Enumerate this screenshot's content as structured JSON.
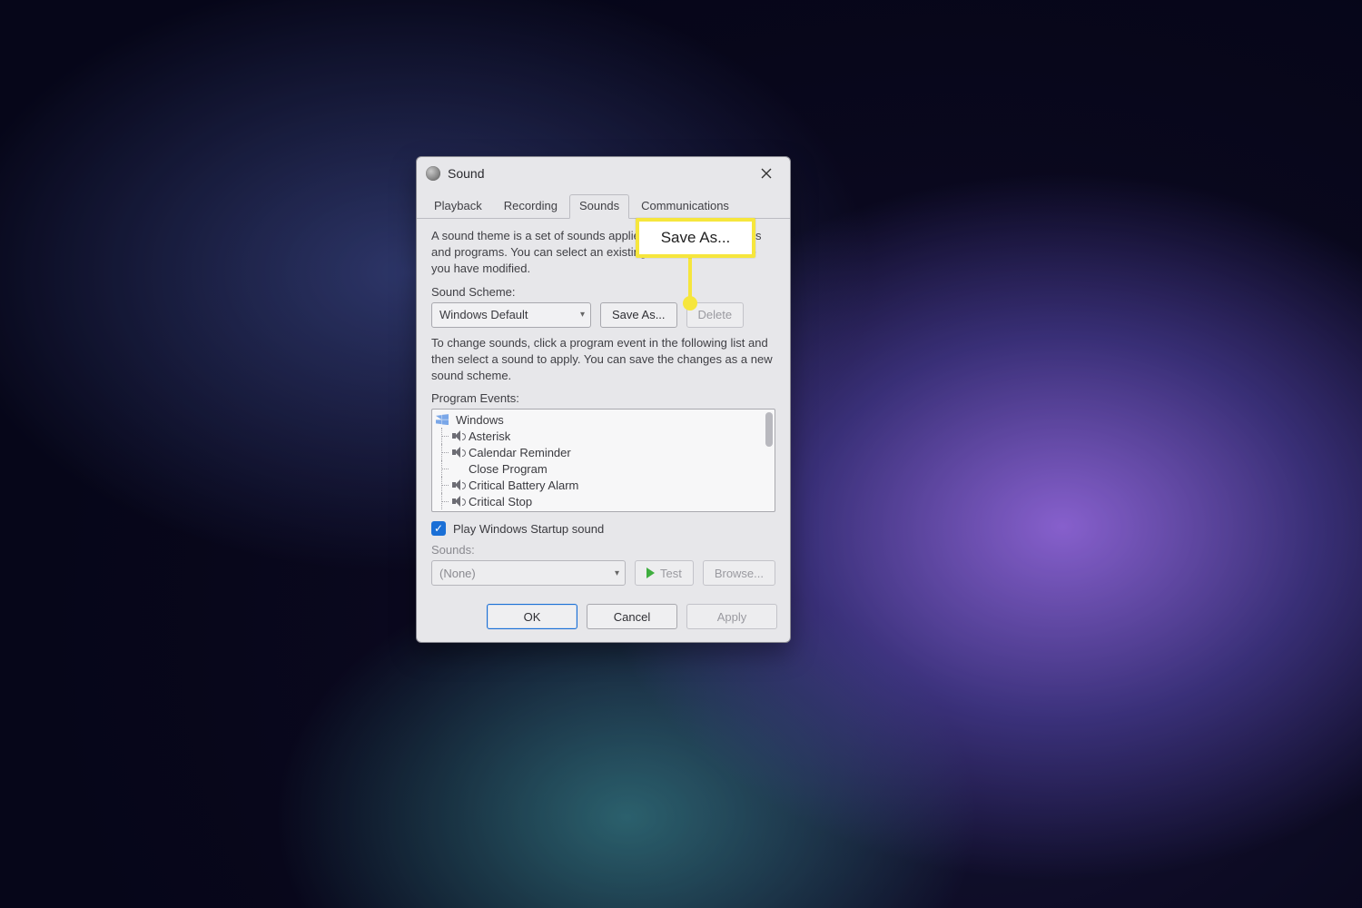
{
  "window": {
    "title": "Sound"
  },
  "tabs": {
    "playback": "Playback",
    "recording": "Recording",
    "sounds": "Sounds",
    "communications": "Communications"
  },
  "description1": "A sound theme is a set of sounds applied to events in Windows and programs.  You can select an existing scheme or save one you have modified.",
  "scheme_label": "Sound Scheme:",
  "scheme_value": "Windows Default",
  "save_as": "Save As...",
  "delete": "Delete",
  "description2": "To change sounds, click a program event in the following list and then select a sound to apply.  You can save the changes as a new sound scheme.",
  "events_label": "Program Events:",
  "events": {
    "root": "Windows",
    "items": [
      "Asterisk",
      "Calendar Reminder",
      "Close Program",
      "Critical Battery Alarm",
      "Critical Stop"
    ]
  },
  "startup_label": "Play Windows Startup sound",
  "sounds_label": "Sounds:",
  "sounds_value": "(None)",
  "test": "Test",
  "browse": "Browse...",
  "footer": {
    "ok": "OK",
    "cancel": "Cancel",
    "apply": "Apply"
  },
  "callout": "Save As..."
}
